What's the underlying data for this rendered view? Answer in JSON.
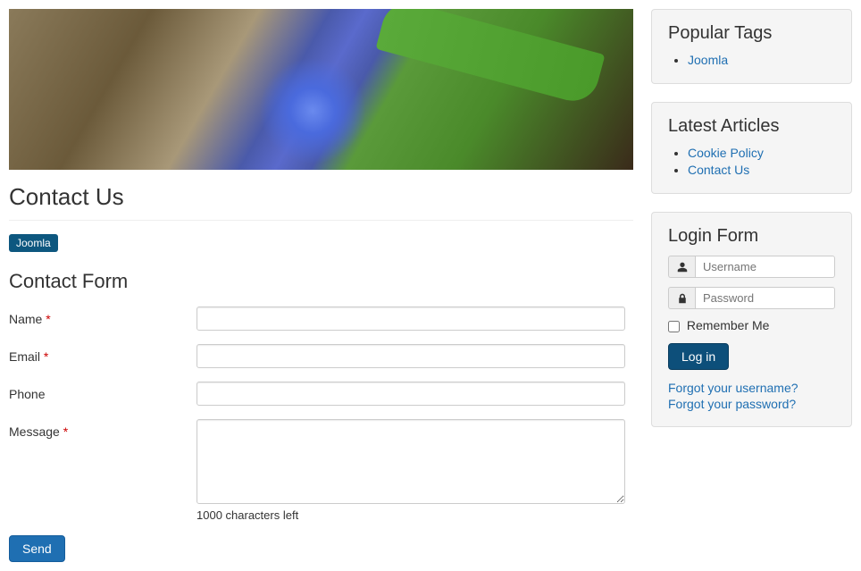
{
  "page": {
    "title": "Contact Us",
    "tag": "Joomla"
  },
  "contactForm": {
    "heading": "Contact Form",
    "fields": {
      "name": {
        "label": "Name",
        "required": "*",
        "value": ""
      },
      "email": {
        "label": "Email",
        "required": "*",
        "value": ""
      },
      "phone": {
        "label": "Phone",
        "required": "",
        "value": ""
      },
      "message": {
        "label": "Message",
        "required": "*",
        "value": ""
      }
    },
    "charCounter": "1000 characters left",
    "submitLabel": "Send"
  },
  "sidebar": {
    "popularTags": {
      "heading": "Popular Tags",
      "items": [
        "Joomla"
      ]
    },
    "latestArticles": {
      "heading": "Latest Articles",
      "items": [
        "Cookie Policy",
        "Contact Us"
      ]
    },
    "loginForm": {
      "heading": "Login Form",
      "usernamePlaceholder": "Username",
      "passwordPlaceholder": "Password",
      "rememberLabel": "Remember Me",
      "loginLabel": "Log in",
      "forgotUsername": "Forgot your username?",
      "forgotPassword": "Forgot your password?"
    }
  }
}
